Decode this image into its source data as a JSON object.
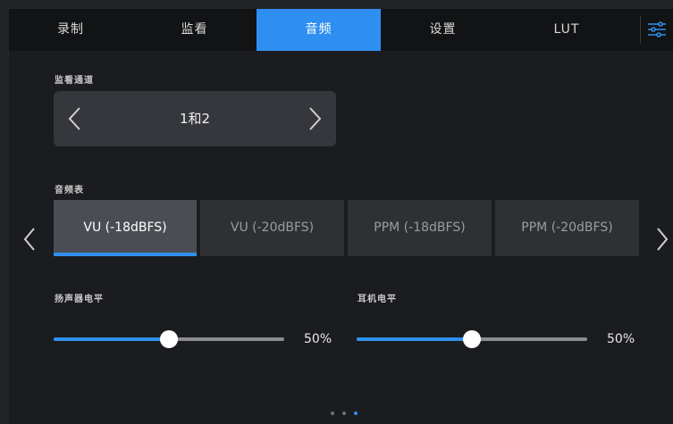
{
  "tabs": [
    {
      "label": "录制"
    },
    {
      "label": "监看"
    },
    {
      "label": "音频"
    },
    {
      "label": "设置"
    },
    {
      "label": "LUT"
    }
  ],
  "active_tab": "音频",
  "monitor_channel": {
    "label": "监看通道",
    "value": "1和2"
  },
  "audio_meter": {
    "label": "音频表",
    "options": [
      "VU (-18dBFS)",
      "VU (-20dBFS)",
      "PPM (-18dBFS)",
      "PPM (-20dBFS)"
    ],
    "selected": "VU (-18dBFS)"
  },
  "speaker_level": {
    "label": "扬声器电平",
    "value_text": "50%",
    "fraction": 0.5
  },
  "headphone_level": {
    "label": "耳机电平",
    "value_text": "50%",
    "fraction": 0.5
  },
  "pagination": {
    "total": 3,
    "current": 3
  },
  "colors": {
    "accent": "#2f8ff0",
    "background": "#1b1c1f",
    "tabbar": "#121315"
  },
  "icons": [
    "settings-sliders-icon",
    "chevron-left-icon",
    "chevron-right-icon"
  ]
}
